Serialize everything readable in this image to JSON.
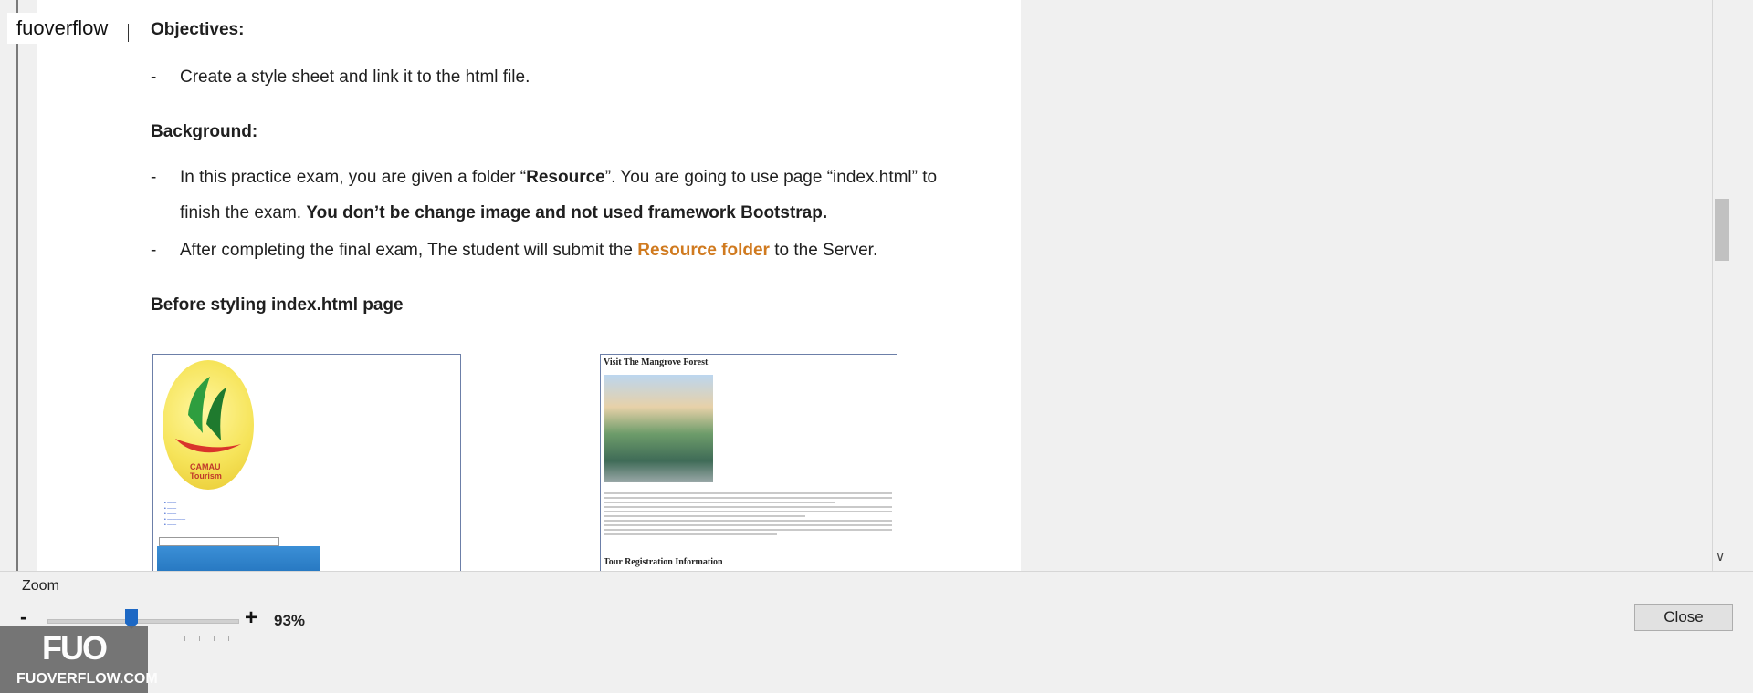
{
  "app": {
    "label": "fuoverflow"
  },
  "document": {
    "objectives_heading": "Objectives:",
    "objective_1": "Create a style sheet and link it to the html file.",
    "background_heading": "Background:",
    "background_1_part1": "In this practice exam, you are given a folder “",
    "background_1_bold": "Resource",
    "background_1_part2": "”. You are going to use page “index.html”  to",
    "background_1_line2_plain": "finish the exam. ",
    "background_1_line2_bold": "You don’t be change image and not used framework Bootstrap.",
    "background_2_part1": "After completing the final exam, The student will submit the ",
    "background_2_highlight": "Resource folder",
    "background_2_part2": " to the Server.",
    "before_heading": "Before styling index.html page",
    "bullet": "-",
    "left_preview": {
      "logo_text": "CAMAU Tourism"
    },
    "right_preview": {
      "title": "Visit The Mangrove Forest",
      "section_title": "Tour Registration Information"
    },
    "highlight_color": "#d07a1f"
  },
  "scrollbar": {
    "down_arrow": "∨"
  },
  "zoom": {
    "label": "Zoom",
    "minus": "-",
    "plus": "+",
    "value": "93%"
  },
  "close_button": {
    "label": "Close"
  },
  "watermark": {
    "logo": "FUO",
    "site": "FUOVERFLOW.COM"
  }
}
